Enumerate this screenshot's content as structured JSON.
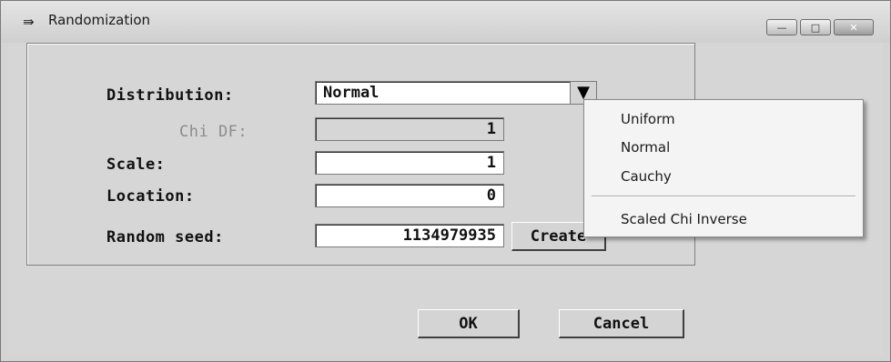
{
  "window": {
    "title": "Randomization",
    "icon": "arrow-icon",
    "controls": {
      "minimize": "—",
      "maximize": "□",
      "close": "✕"
    }
  },
  "form": {
    "distribution": {
      "label": "Distribution:",
      "value": "Normal"
    },
    "chi_df": {
      "label": "Chi DF:",
      "value": "1"
    },
    "scale": {
      "label": "Scale:",
      "value": "1"
    },
    "location": {
      "label": "Location:",
      "value": "0"
    },
    "random_seed": {
      "label": "Random seed:",
      "value": "1134979935",
      "button": "Create"
    }
  },
  "dropdown_menu": {
    "options": [
      "Uniform",
      "Normal",
      "Cauchy",
      "Scaled Chi Inverse"
    ]
  },
  "footer": {
    "ok": "OK",
    "cancel": "Cancel"
  },
  "arrow_glyph": "▼"
}
